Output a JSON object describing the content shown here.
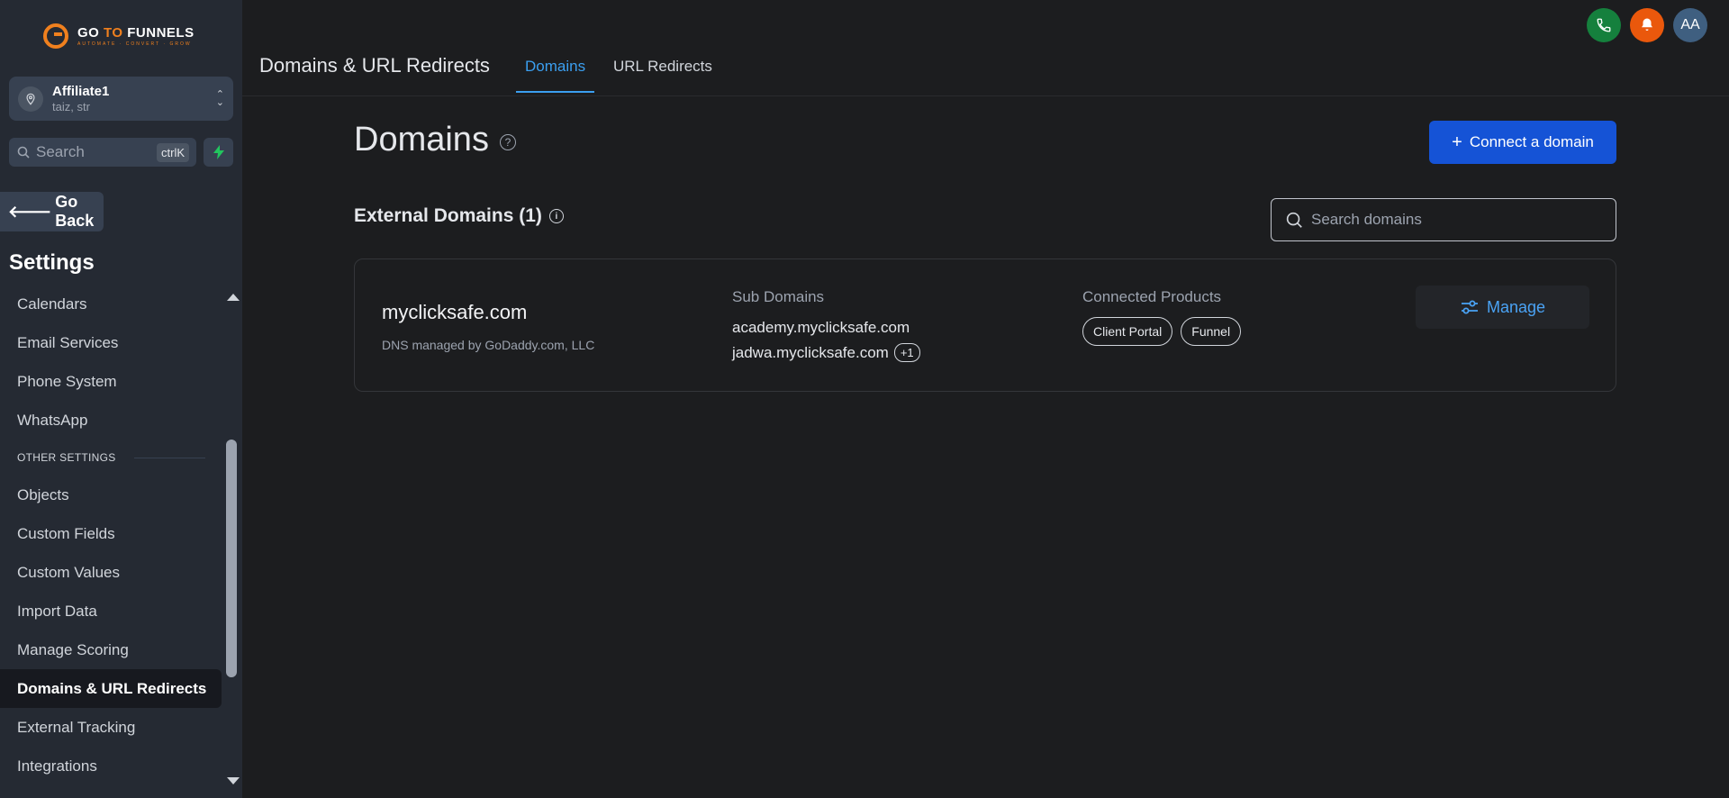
{
  "brand": {
    "name_part1": "GO ",
    "name_part2": "TO",
    "name_part3": " FUNNELS",
    "tagline": "AUTOMATE · CONVERT · GROW"
  },
  "account": {
    "name": "Affiliate1",
    "subtitle": "taiz, str"
  },
  "search": {
    "label": "Search",
    "shortcut": "ctrlK"
  },
  "sidebar": {
    "go_back": "Go Back",
    "heading": "Settings",
    "items_top": [
      "Calendars",
      "Email Services",
      "Phone System",
      "WhatsApp"
    ],
    "section_label": "OTHER SETTINGS",
    "items_bottom": [
      "Objects",
      "Custom Fields",
      "Custom Values",
      "Import Data",
      "Manage Scoring",
      "Domains & URL Redirects",
      "External Tracking",
      "Integrations"
    ],
    "active": "Domains & URL Redirects"
  },
  "header": {
    "title": "Domains & URL Redirects",
    "tabs": [
      "Domains",
      "URL Redirects"
    ],
    "active_tab": "Domains",
    "avatar_initials": "AA"
  },
  "main": {
    "title": "Domains",
    "connect_label": "Connect a domain",
    "external_title": "External Domains (1)",
    "search_placeholder": "Search domains"
  },
  "domain_card": {
    "name": "myclicksafe.com",
    "dns": "DNS managed by GoDaddy.com, LLC",
    "sub_label": "Sub Domains",
    "sub_domains": [
      "academy.myclicksafe.com",
      "jadwa.myclicksafe.com"
    ],
    "more_count": "+1",
    "products_label": "Connected Products",
    "products": [
      "Client Portal",
      "Funnel"
    ],
    "manage_label": "Manage"
  },
  "colors": {
    "accent": "#3b9ff0",
    "primary_button": "#1553d6",
    "brand_orange": "#f0801e",
    "phone_green": "#15803d",
    "bell_orange": "#ea580c"
  }
}
